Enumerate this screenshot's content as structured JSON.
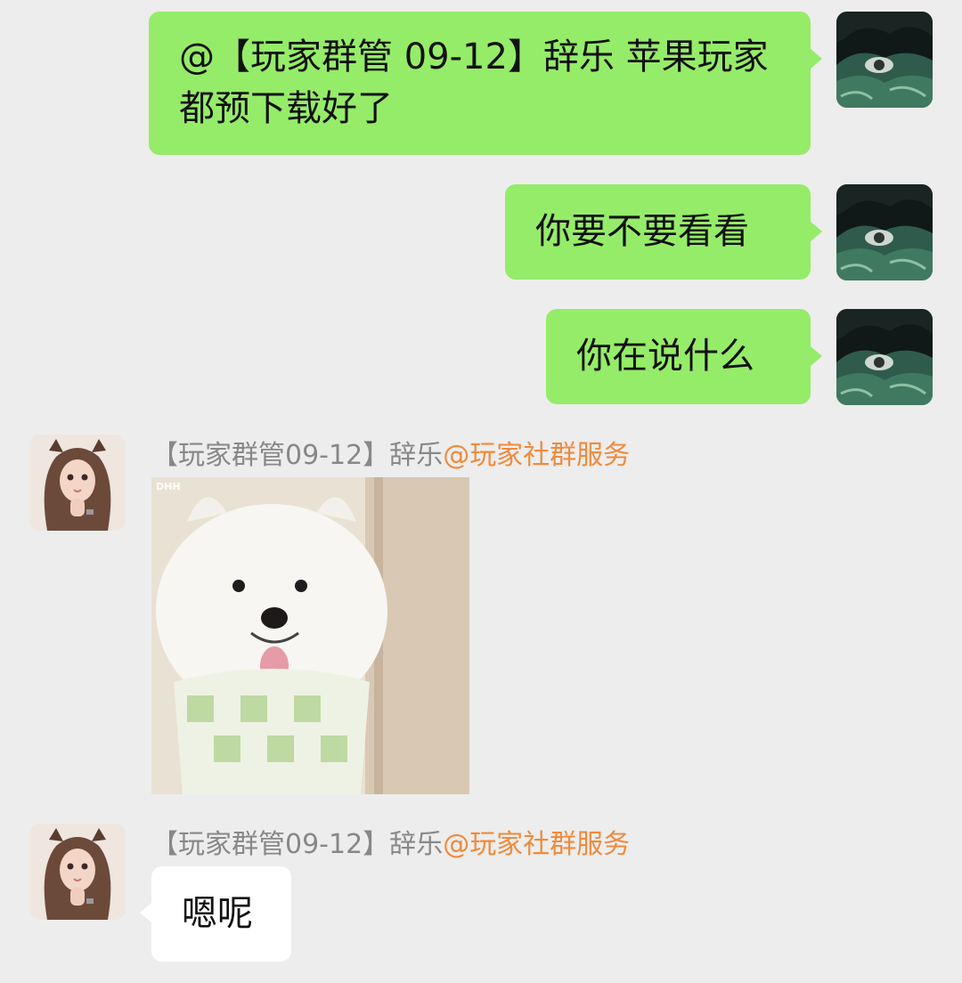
{
  "messages": [
    {
      "direction": "out",
      "text": "@【玩家群管 09-12】辞乐  苹果玩家都预下载好了"
    },
    {
      "direction": "out",
      "text": "你要不要看看"
    },
    {
      "direction": "out",
      "text": "你在说什么"
    },
    {
      "direction": "in",
      "sender_name": "【玩家群管09-12】辞乐",
      "sender_group": "@玩家社群服务",
      "type": "sticker",
      "sticker_watermark": "DHH"
    },
    {
      "direction": "in",
      "sender_name": "【玩家群管09-12】辞乐",
      "sender_group": "@玩家社群服务",
      "text": "嗯呢"
    }
  ],
  "colors": {
    "background": "#ededed",
    "outgoing_bubble": "#95ec69",
    "incoming_bubble": "#ffffff",
    "mention": "#f08a3c",
    "sender_name": "#888888"
  },
  "icons": {
    "self_avatar": "dark-green-anime-avatar",
    "other_avatar": "girl-avatar",
    "sticker": "samoyed-dog-sticker"
  }
}
